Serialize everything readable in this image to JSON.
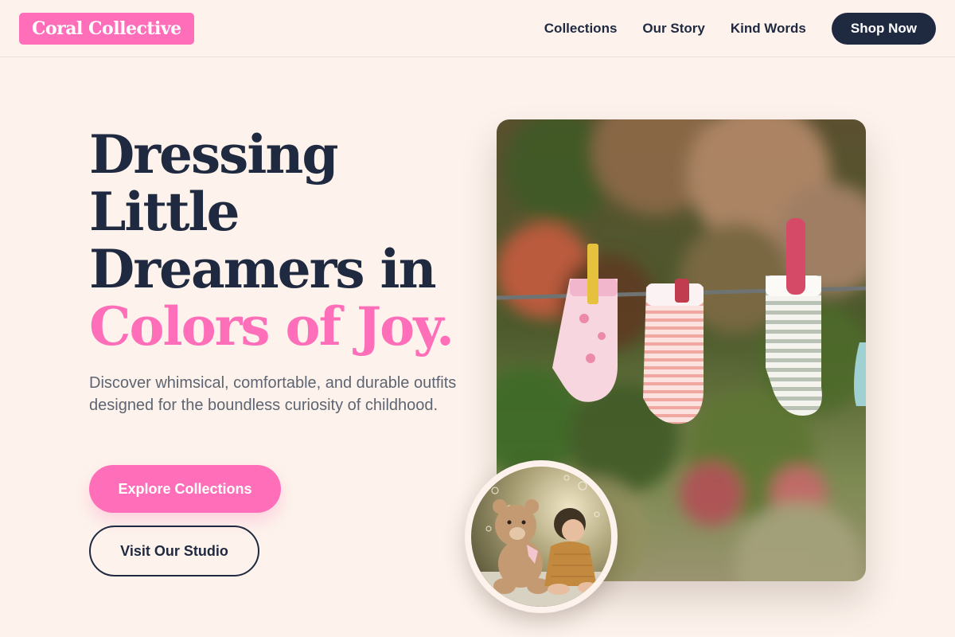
{
  "header": {
    "logo": "Coral Collective",
    "nav": [
      "Collections",
      "Our Story",
      "Kind Words"
    ],
    "cta": "Shop Now"
  },
  "hero": {
    "title_lines": [
      "Dressing",
      "Little",
      "Dreamers in"
    ],
    "title_accent": "Colors of Joy.",
    "description": "Discover whimsical, comfortable, and durable outfits designed for the boundless curiosity of childhood.",
    "primary_button": "Explore Collections",
    "secondary_button": "Visit Our Studio"
  },
  "images": {
    "main": "baby-socks-on-clothesline-photo",
    "inset": "child-with-teddy-bear-photo"
  },
  "colors": {
    "background": "#fdf3ec",
    "accent": "#ff6eb9",
    "navy": "#1f2940",
    "body_text": "#5e6572"
  }
}
